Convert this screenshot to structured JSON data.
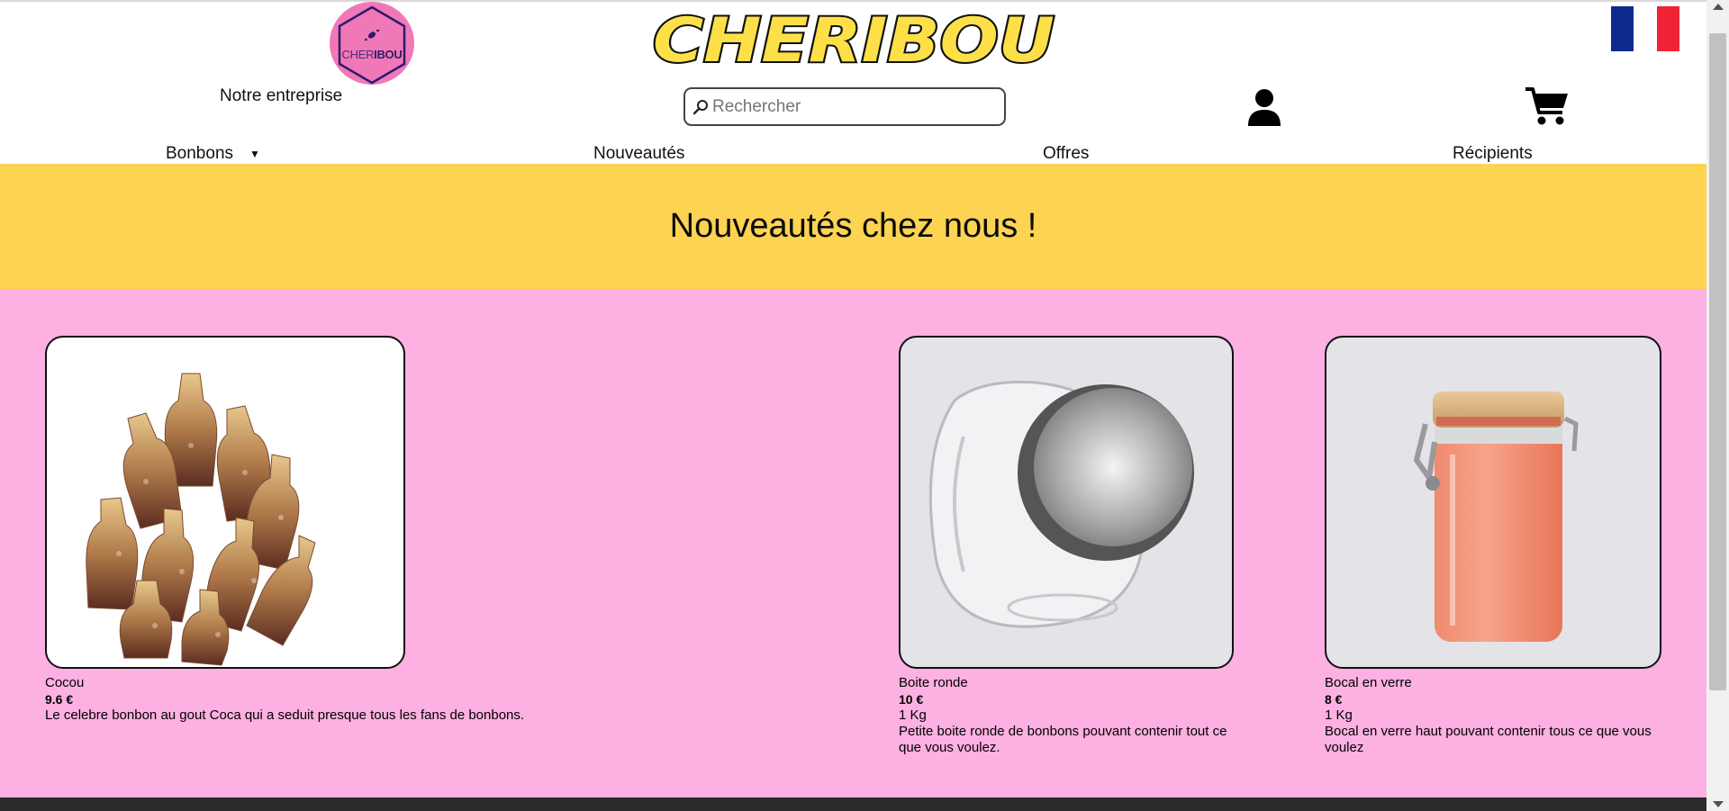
{
  "header": {
    "logo_text_light": "CHER",
    "logo_text_bold": "IBOU",
    "brand_title": "CHERIBOU",
    "company_link": "Notre entreprise",
    "language_flag": "fr-flag-icon",
    "search": {
      "placeholder": "Rechercher"
    },
    "icons": {
      "account": "user-icon",
      "cart": "cart-icon",
      "search": "search-icon"
    }
  },
  "nav": {
    "items": [
      {
        "label": "Bonbons",
        "has_dropdown": true
      },
      {
        "label": "Nouveautés"
      },
      {
        "label": "Offres"
      },
      {
        "label": "Récipients"
      }
    ]
  },
  "hero": {
    "title": "Nouveautés chez nous !"
  },
  "products": [
    {
      "name": "Cocou",
      "price": "9.6 €",
      "weight": "",
      "description": "Le celebre bonbon au gout Coca qui a seduit presque tous les fans de bonbons."
    },
    {
      "name": "Boite ronde",
      "price": "10 €",
      "weight": "1 Kg",
      "description": "Petite boite ronde de bonbons pouvant contenir tout ce que vous voulez."
    },
    {
      "name": "Bocal en verre",
      "price": "8 €",
      "weight": "1 Kg",
      "description": "Bocal en verre haut pouvant contenir tous ce que vous voulez"
    }
  ],
  "colors": {
    "hero_bg": "#fdd352",
    "products_bg": "#fdb0e2",
    "logo_bg": "#f178b6",
    "brand_yellow": "#fde047"
  }
}
